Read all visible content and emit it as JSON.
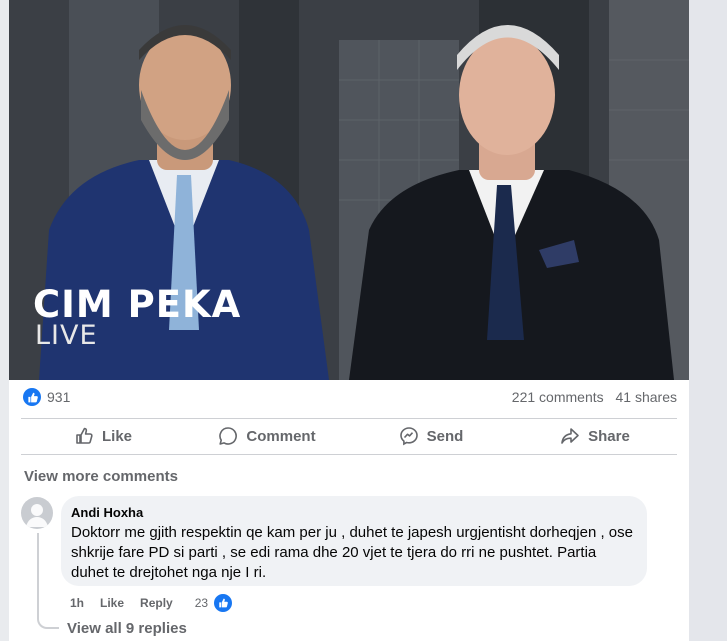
{
  "post": {
    "image": {
      "title": "CIM PEKA",
      "subtitle": "LIVE"
    },
    "stats": {
      "likes": "931",
      "comments": "221 comments",
      "shares": "41 shares"
    },
    "actions": {
      "like": "Like",
      "comment": "Comment",
      "send": "Send",
      "share": "Share"
    }
  },
  "comments_section": {
    "view_more": "View more comments",
    "comment": {
      "author": "Andi Hoxha",
      "text": "Doktorr me gjith respektin qe kam per ju , duhet te japesh urgjentisht dorheqjen , ose shkrije fare PD si parti , se edi rama dhe 20 vjet te tjera do rri ne pushtet. Partia duhet te drejtohet nga nje I ri.",
      "time": "1h",
      "like": "Like",
      "reply": "Reply",
      "reaction_count": "23"
    },
    "view_replies": "View all 9 replies"
  },
  "colors": {
    "accent": "#1877f2",
    "muted_text": "#65676b",
    "bubble": "#f0f2f5"
  },
  "icons": [
    "like-badge-icon",
    "like-outline-icon",
    "comment-icon",
    "messenger-icon",
    "share-icon",
    "avatar-placeholder-icon"
  ]
}
